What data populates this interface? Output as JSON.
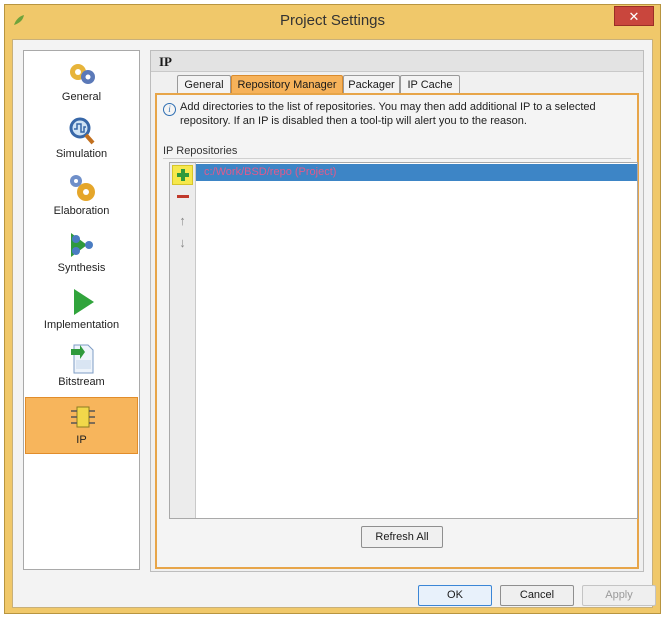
{
  "window": {
    "title": "Project Settings",
    "close_glyph": "✕"
  },
  "sidebar": {
    "items": [
      {
        "label": "General",
        "icon": "general-gear-icon"
      },
      {
        "label": "Simulation",
        "icon": "magnifier-waveform-icon"
      },
      {
        "label": "Elaboration",
        "icon": "elaboration-gears-icon"
      },
      {
        "label": "Synthesis",
        "icon": "synthesis-arrows-icon"
      },
      {
        "label": "Implementation",
        "icon": "play-triangle-icon"
      },
      {
        "label": "Bitstream",
        "icon": "bitstream-file-icon"
      },
      {
        "label": "IP",
        "icon": "ip-chip-icon",
        "selected": true
      }
    ],
    "selected_color": "#f7b55c"
  },
  "panel": {
    "title": "IP",
    "tabs": [
      {
        "label": "General"
      },
      {
        "label": "Repository Manager",
        "active": true
      },
      {
        "label": "Packager"
      },
      {
        "label": "IP Cache"
      }
    ],
    "info_text": "Add directories to the list of repositories. You may then add additional IP to a selected repository. If an IP is disabled then a tool-tip will alert you to the reason.",
    "repositories_label": "IP Repositories",
    "repositories": [
      {
        "path": "c:/Work/BSD/repo (Project)",
        "selected": true
      }
    ],
    "tools": {
      "add": "+",
      "remove": "−",
      "up": "↑",
      "down": "↓"
    },
    "refresh_label": "Refresh All"
  },
  "footer": {
    "ok_label": "OK",
    "cancel_label": "Cancel",
    "apply_label": "Apply"
  },
  "colors": {
    "accent": "#f6b25a",
    "selection": "#3d85c6",
    "add_highlight": "#f6e84c"
  }
}
